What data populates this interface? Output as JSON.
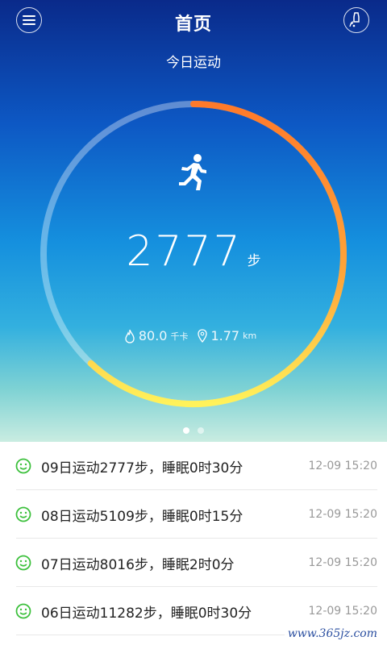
{
  "header": {
    "title": "首页",
    "menu_icon": "menu-icon",
    "device_icon": "wristband-icon"
  },
  "today": {
    "label": "今日运动",
    "steps": "2777",
    "steps_unit": "步",
    "calories": "80.0",
    "calories_unit": "千卡",
    "distance": "1.77",
    "distance_unit": "km",
    "progress": 0.62
  },
  "pager": {
    "count": 2,
    "active": 0
  },
  "records": [
    {
      "text": "09日运动2777步，睡眠0时30分",
      "time": "12-09 15:20"
    },
    {
      "text": "08日运动5109步，睡眠0时15分",
      "time": "12-09 15:20"
    },
    {
      "text": "07日运动8016步，睡眠2时0分",
      "time": "12-09 15:20"
    },
    {
      "text": "06日运动11282步，睡眠0时30分",
      "time": "12-09 15:20"
    }
  ],
  "watermark": "www.365jz.com",
  "colors": {
    "ring_start": "#fff25a",
    "ring_end": "#ff7a2a",
    "ring_track": "#ffffff",
    "smile_icon": "#3cc03c"
  }
}
